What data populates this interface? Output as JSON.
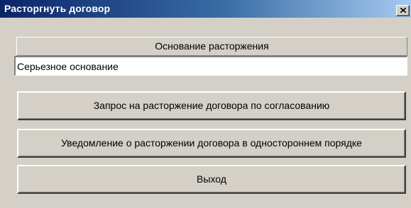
{
  "window": {
    "title": "Расторгнуть договор",
    "close_symbol": "×",
    "icons": {
      "close": "close-icon"
    }
  },
  "reason": {
    "caption": "Основание расторжения",
    "value": "Серьезное основание"
  },
  "buttons": {
    "request_label": "Запрос на расторжение договора по согласованию",
    "notice_label": "Уведомление о расторжении договора в одностороннем порядке",
    "exit_label": "Выход"
  },
  "colors": {
    "titlebar_start": "#0a246a",
    "titlebar_end": "#a6caf0",
    "face": "#d4d0c8"
  }
}
